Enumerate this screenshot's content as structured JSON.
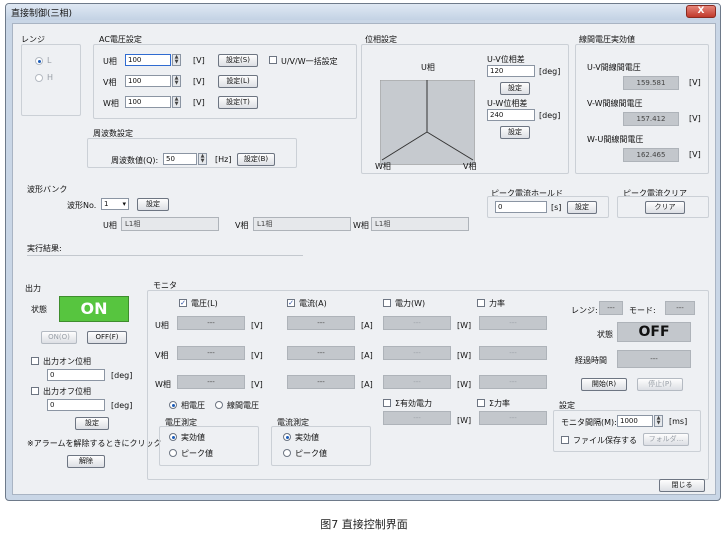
{
  "window": {
    "title": "直接制御(三相)",
    "close_label": "X"
  },
  "range": {
    "group_label": "レンジ",
    "options": [
      "L",
      "H"
    ]
  },
  "ac_voltage": {
    "group_label": "AC電圧設定",
    "rows": [
      {
        "label": "U相",
        "value": "100",
        "unit": "[V]",
        "button": "設定(S)"
      },
      {
        "label": "V相",
        "value": "100",
        "unit": "[V]",
        "button": "設定(L)"
      },
      {
        "label": "W相",
        "value": "100",
        "unit": "[V]",
        "button": "設定(T)"
      }
    ],
    "batch_label": "U/V/W一括設定"
  },
  "frequency": {
    "group_label": "周波数設定",
    "label": "周波数値(Q):",
    "value": "50",
    "unit": "[Hz]",
    "button": "設定(B)"
  },
  "phase": {
    "group_label": "位相設定",
    "u_label": "U相",
    "v_label": "V相",
    "w_label": "W相",
    "uv_label": "U-V位相差",
    "uv_value": "120",
    "uw_label": "U-W位相差",
    "uw_value": "240",
    "unit": "[deg]",
    "button": "設定"
  },
  "line_voltage": {
    "group_label": "線間電圧実効値",
    "rows": [
      {
        "label": "U-V間線間電圧",
        "value": "159.581",
        "unit": "[V]"
      },
      {
        "label": "V-W間線間電圧",
        "value": "157.412",
        "unit": "[V]"
      },
      {
        "label": "W-U間線間電圧",
        "value": "162.465",
        "unit": "[V]"
      }
    ]
  },
  "waveform": {
    "group_label": "波形バンク",
    "no_label": "波形No.",
    "no_value": "1",
    "button": "設定",
    "u_label": "U相",
    "u_value": "L1相",
    "v_label": "V相",
    "v_value": "L1相",
    "w_label": "W相",
    "w_value": "L1相"
  },
  "peak_hold": {
    "group_label": "ピーク電流ホールド",
    "value": "0",
    "unit": "[s]",
    "button": "設定"
  },
  "peak_clear": {
    "group_label": "ピーク電流クリア",
    "button": "クリア"
  },
  "result": {
    "label": "実行結果:"
  },
  "output": {
    "group_label": "出力",
    "state_label": "状態",
    "state_value": "ON",
    "on_button": "ON(O)",
    "off_button": "OFF(F)",
    "on_phase_label": "出力オン位相",
    "on_phase_value": "0",
    "on_phase_unit": "[deg]",
    "off_phase_label": "出力オフ位相",
    "off_phase_value": "0",
    "off_phase_unit": "[deg]",
    "set_button": "設定",
    "alarm_note": "※アラームを解除するときにクリック",
    "release_button": "解除"
  },
  "monitor": {
    "group_label": "モニタ",
    "headers": [
      {
        "label": "電圧(L)",
        "checked": true
      },
      {
        "label": "電流(A)",
        "checked": true
      },
      {
        "label": "電力(W)",
        "checked": false
      },
      {
        "label": "力率",
        "checked": false
      }
    ],
    "row_labels": [
      "U相",
      "V相",
      "W相"
    ],
    "units": [
      "[V]",
      "[A]",
      "[W]"
    ],
    "dash": "---",
    "sigma_power_label": "Σ有効電力",
    "sigma_pf_label": "Σ力率",
    "sigma_unit": "[W]",
    "phase_voltage_label": "相電圧",
    "line_voltage_label": "線間電圧",
    "voltage_meas_label": "電圧測定",
    "current_meas_label": "電流測定",
    "effective_label": "実効値",
    "peak_label": "ピーク値",
    "range_label": "レンジ:",
    "range_value": "---",
    "mode_label": "モード:",
    "mode_value": "---",
    "state_label": "状態",
    "state_value": "OFF",
    "elapsed_label": "経過時間",
    "elapsed_value": "---",
    "start_button": "開始(R)",
    "stop_button": "停止(P)"
  },
  "settings": {
    "group_label": "設定",
    "interval_label": "モニタ間隔(M):",
    "interval_value": "1000",
    "interval_unit": "[ms]",
    "save_label": "ファイル保存する",
    "folder_button": "フォルダ..."
  },
  "close_button": "閉じる",
  "caption": "图7  直接控制界面",
  "colors": {
    "on_green": "#57c53f",
    "readonly_gray": "#c3c7cc",
    "titlebar": "#c3d2e4",
    "close_red": "#c0392b"
  }
}
